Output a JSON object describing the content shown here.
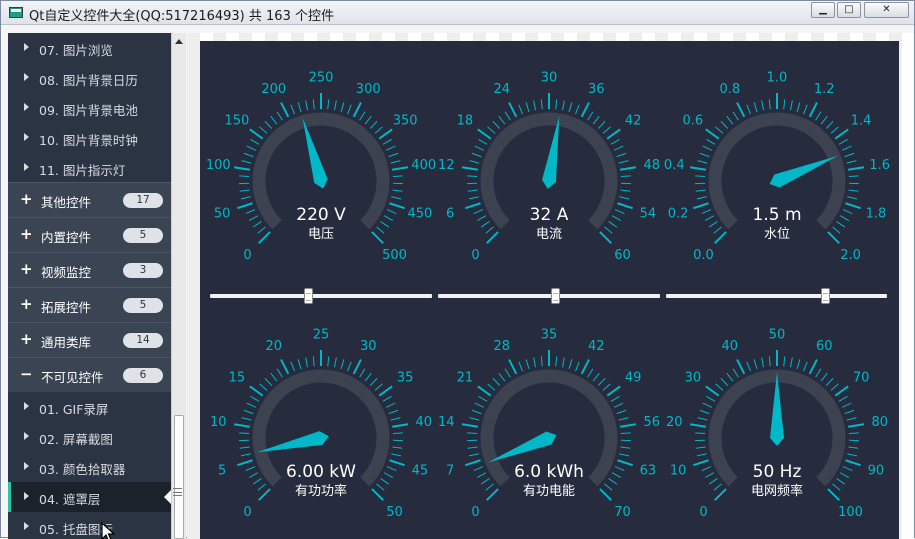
{
  "window": {
    "title": "Qt自定义控件大全(QQ:517216493) 共 163 个控件",
    "min_glyph": "▁",
    "max_glyph": "□",
    "close_glyph": "✕"
  },
  "sidebar": {
    "top_items": [
      {
        "label": "07. 图片浏览"
      },
      {
        "label": "08. 图片背景日历"
      },
      {
        "label": "09. 图片背景电池"
      },
      {
        "label": "10. 图片背景时钟"
      },
      {
        "label": "11. 图片指示灯"
      }
    ],
    "groups": [
      {
        "sign": "+",
        "label": "其他控件",
        "count": "17"
      },
      {
        "sign": "+",
        "label": "内置控件",
        "count": "5"
      },
      {
        "sign": "+",
        "label": "视频监控",
        "count": "3"
      },
      {
        "sign": "+",
        "label": "拓展控件",
        "count": "5"
      },
      {
        "sign": "+",
        "label": "通用类库",
        "count": "14"
      },
      {
        "sign": "−",
        "label": "不可见控件",
        "count": "6"
      }
    ],
    "bottom_items": [
      {
        "label": "01. GIF录屏",
        "selected": false
      },
      {
        "label": "02. 屏幕截图",
        "selected": false
      },
      {
        "label": "03. 颜色拾取器",
        "selected": false
      },
      {
        "label": "04. 遮罩层",
        "selected": true
      },
      {
        "label": "05. 托盘图标",
        "selected": false
      }
    ]
  },
  "colors": {
    "panel_bg": "#262b3e",
    "arc": "#3c4250",
    "accent": "#00b8c8",
    "label": "#ffffff"
  },
  "gauges": [
    {
      "value_text": "220 V",
      "unit_label": "电压",
      "min": 0,
      "max": 500,
      "value": 220,
      "ticks": [
        "0",
        "50",
        "100",
        "150",
        "200",
        "250",
        "300",
        "350",
        "400",
        "450",
        "500"
      ]
    },
    {
      "value_text": "32 A",
      "unit_label": "电流",
      "min": 0,
      "max": 60,
      "value": 32,
      "ticks": [
        "0",
        "6",
        "12",
        "18",
        "24",
        "30",
        "36",
        "42",
        "48",
        "54",
        "60"
      ]
    },
    {
      "value_text": "1.5 m",
      "unit_label": "水位",
      "min": 0,
      "max": 2,
      "value": 1.5,
      "ticks": [
        "0.0",
        "0.2",
        "0.4",
        "0.6",
        "0.8",
        "1.0",
        "1.2",
        "1.4",
        "1.6",
        "1.8",
        "2.0"
      ]
    },
    {
      "value_text": "6.00 kW",
      "unit_label": "有功功率",
      "min": 0,
      "max": 50,
      "value": 6,
      "ticks": [
        "0",
        "5",
        "10",
        "15",
        "20",
        "25",
        "30",
        "35",
        "40",
        "45",
        "50"
      ]
    },
    {
      "value_text": "6.0 kWh",
      "unit_label": "有功电能",
      "min": 0,
      "max": 70,
      "value": 6,
      "ticks": [
        "0",
        "7",
        "14",
        "21",
        "28",
        "35",
        "42",
        "49",
        "56",
        "63",
        "70"
      ]
    },
    {
      "value_text": "50 Hz",
      "unit_label": "电网频率",
      "min": 0,
      "max": 100,
      "value": 50,
      "ticks": [
        "0",
        "10",
        "20",
        "30",
        "40",
        "50",
        "60",
        "70",
        "80",
        "90",
        "100"
      ]
    }
  ],
  "sliders": [
    {
      "value": 0.44
    },
    {
      "value": 0.53
    },
    {
      "value": 0.73
    }
  ]
}
